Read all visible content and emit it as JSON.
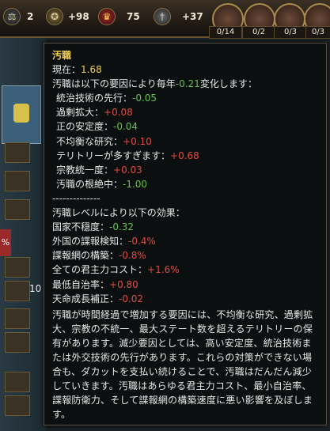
{
  "topbar": {
    "resources": [
      {
        "icon": "stability-icon",
        "value": "2"
      },
      {
        "icon": "prestige-medal-icon",
        "value": "+98"
      },
      {
        "icon": "legitimacy-crown-icon",
        "value": "75"
      },
      {
        "icon": "army-tradition-sword-icon",
        "value": "+37"
      }
    ],
    "advisor_counters": [
      "0/14",
      "0/2",
      "0/3",
      "0/3"
    ]
  },
  "side": {
    "red_mark": "%",
    "value_10": "10"
  },
  "tooltip": {
    "title": "汚職",
    "current_label": "現在：",
    "current_value": "1.68",
    "yearly_prefix": "汚職は以下の要因により毎年",
    "yearly_value": "-0.21",
    "yearly_suffix": "変化します：",
    "factors": [
      {
        "label": "統治技術の先行：",
        "value": "-0.05",
        "tone": "pos"
      },
      {
        "label": "過剰拡大：",
        "value": "+0.08",
        "tone": "neg"
      },
      {
        "label": "正の安定度：",
        "value": "-0.04",
        "tone": "pos"
      },
      {
        "label": "不均衡な研究：",
        "value": "+0.10",
        "tone": "neg"
      },
      {
        "label": "テリトリーが多すぎます：",
        "value": "+0.68",
        "tone": "neg"
      },
      {
        "label": "宗教統一度：",
        "value": "+0.03",
        "tone": "neg"
      },
      {
        "label": "汚職の根絶中：",
        "value": "-1.00",
        "tone": "pos"
      }
    ],
    "separator": "--------------",
    "effects_header": "汚職レベルにより以下の効果：",
    "effects": [
      {
        "label": "国家不穏度：",
        "value": "-0.32",
        "tone": "pos"
      },
      {
        "label": "外国の諜報検知：",
        "value": "-0.4%",
        "tone": "neg"
      },
      {
        "label": "諜報網の構築：",
        "value": "-0.8%",
        "tone": "neg"
      },
      {
        "label": "全ての君主力コスト：",
        "value": "+1.6%",
        "tone": "neg"
      },
      {
        "label": "最低自治率：",
        "value": "+0.80",
        "tone": "neg"
      },
      {
        "label": "天命成長補正：",
        "value": "-0.02",
        "tone": "neg"
      }
    ],
    "description": "汚職が時間経過で増加する要因には、不均衡な研究、過剰拡大、宗教の不統一、最大ステート数を超えるテリトリーの保有があります。減少要因としては、高い安定度、統治技術または外交技術の先行があります。これらの対策ができない場合も、ダカットを支払い続けることで、汚職はだんだん減少していきます。汚職はあらゆる君主力コスト、最小自治率、諜報防衛力、そして諜報網の構築速度に悪い影響を及ぼします。"
  }
}
